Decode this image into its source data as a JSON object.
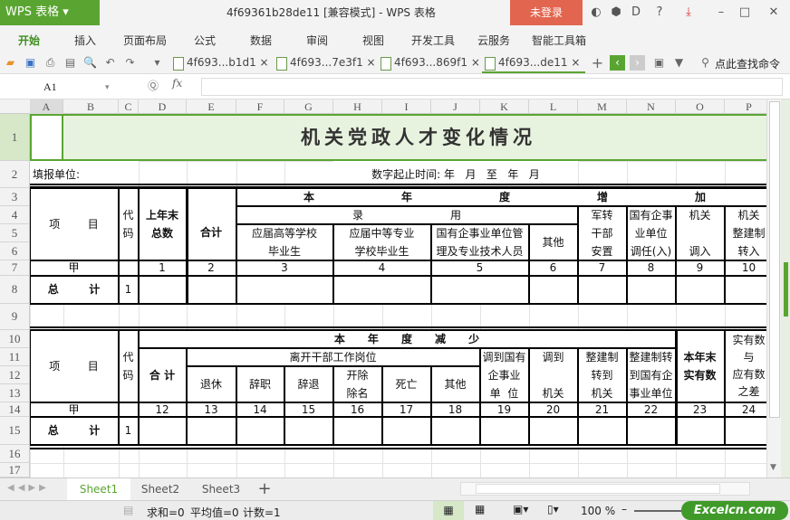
{
  "app": {
    "logo": "WPS 表格",
    "doc_title": "4f69361b28de11 [兼容模式] - WPS 表格",
    "login": "未登录"
  },
  "menu": [
    "开始",
    "插入",
    "页面布局",
    "公式",
    "数据",
    "审阅",
    "视图",
    "开发工具",
    "云服务",
    "智能工具箱"
  ],
  "doc_tabs": [
    "4f693...b1d1",
    "4f693...7e3f1",
    "4f693...869f1",
    "4f693...de11"
  ],
  "search_cmd": "点此查找命令",
  "formula": {
    "cell_ref": "A1",
    "fx": "fx",
    "value": ""
  },
  "columns": [
    "A",
    "B",
    "C",
    "D",
    "E",
    "F",
    "G",
    "H",
    "I",
    "J",
    "K",
    "L",
    "M",
    "N",
    "O",
    "P"
  ],
  "rows": [
    "1",
    "2",
    "3",
    "4",
    "5",
    "6",
    "7",
    "8",
    "9",
    "10",
    "11",
    "12",
    "13",
    "14",
    "15",
    "16",
    "17"
  ],
  "sheet": {
    "title": "机关党政人才变化情况",
    "unit_label": "填报单位:",
    "period_label": "数字起止时间: 年   月   至   年   月",
    "t1": {
      "item": "项        目",
      "code": "代\n码",
      "prev_total": "上年末\n总数",
      "sum": "合计",
      "h_ben": "本",
      "h_nian": "年",
      "h_du": "度",
      "h_zeng": "增",
      "h_jia": "加",
      "lu": "录",
      "yong": "用",
      "c3": "应届高等学校\n毕业生",
      "c4": "应届中等专业\n学校毕业生",
      "c5": "国有企事业单位管\n理及专业技术人员",
      "c6": "其他",
      "c7": "军转\n干部\n安置",
      "c8": "国有企事\n业单位\n调任(入)",
      "c9": "机关\n\n调入",
      "c10": "机关\n整建制\n转入",
      "row_jia": "甲",
      "nums": [
        "1",
        "2",
        "3",
        "4",
        "5",
        "6",
        "7",
        "8",
        "9",
        "10"
      ],
      "total": "总        计",
      "total_code": "1"
    },
    "t2": {
      "item": "项        目",
      "code": "代\n码",
      "header": "本      年      度      减      少",
      "sum": "合 计",
      "leave": "离开干部工作岗位",
      "c13": "退休",
      "c14": "辞职",
      "c15": "辞退",
      "c16": "开除\n除名",
      "c17": "死亡",
      "c18": "其他",
      "c19": "调到国有\n企事业\n单  位",
      "c20": "调到\n\n机关",
      "c21": "整建制\n转到\n机关",
      "c22": "整建制转\n到国有企\n事业单位",
      "c23": "本年末\n实有数",
      "c24": "实有数\n与\n应有数\n之差",
      "row_jia": "甲",
      "nums": [
        "12",
        "13",
        "14",
        "15",
        "16",
        "17",
        "18",
        "19",
        "20",
        "21",
        "22",
        "23",
        "24"
      ],
      "total": "总        计",
      "total_code": "1"
    }
  },
  "sheets": [
    "Sheet1",
    "Sheet2",
    "Sheet3"
  ],
  "status": {
    "sum": "求和=0",
    "avg": "平均值=0",
    "count": "计数=1",
    "zoom": "100 %",
    "watermark": "Excelcn.com"
  },
  "colors": {
    "accent": "#5aa532",
    "login": "#e2654f",
    "title_bg": "#e8f3df"
  }
}
